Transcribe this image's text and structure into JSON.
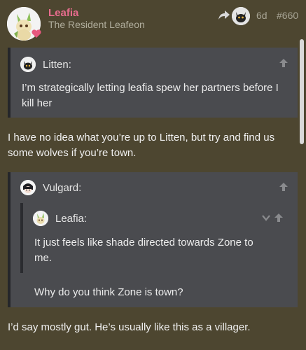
{
  "post": {
    "username": "Leafia",
    "user_title": "The Resident Leafeon",
    "age": "6d",
    "post_number": "#660"
  },
  "quote1": {
    "author": "Litten:",
    "text_line1": "I’m strategically letting leafia spew her partners before I",
    "text_line2": "kill her"
  },
  "reply1": {
    "line1": "I have no idea what you’re up to Litten, but try and find us",
    "line2": "some wolves if you’re town."
  },
  "quote2": {
    "author": "Vulgard:",
    "inner_author": "Leafia:",
    "inner_line1": "It just feels like shade directed towards Zone to",
    "inner_line2": "me.",
    "text": "Why do you think Zone is town?"
  },
  "reply2": {
    "line1": "I’d say mostly gut. He’s usually like this as a villager."
  },
  "colors": {
    "background": "#4d4630",
    "quote_bg": "#4a4b4f",
    "username": "#e86c8e"
  },
  "icons": {
    "reply": "reply-arrow-icon",
    "up": "up-arrow-icon",
    "expand": "chevron-down-icon",
    "heart": "heart-icon"
  }
}
